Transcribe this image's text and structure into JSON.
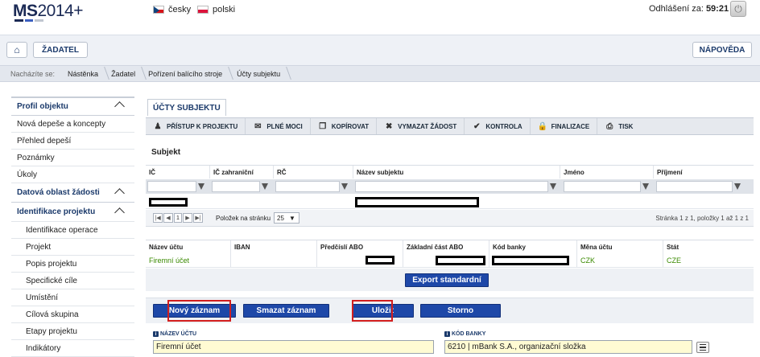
{
  "header": {
    "logo_ms": "MS",
    "logo_year": "2014+",
    "languages": [
      "česky",
      "polski"
    ],
    "logout_label": "Odhlášení za:",
    "logout_timer": "59:21",
    "logo_colors": [
      "#1b2a55",
      "#3b5fc0",
      "#c0c6d0"
    ]
  },
  "menubar": {
    "applicant_label": "ŽADATEL",
    "help_label": "NÁPOVĚDA"
  },
  "breadcrumb": {
    "label": "Nacházíte se:",
    "items": [
      "Nástěnka",
      "Žadatel",
      "Pořízení balícího stroje",
      "Účty subjektu"
    ]
  },
  "sidebar": {
    "items": [
      {
        "label": "Profil objektu",
        "type": "head"
      },
      {
        "label": "Nová depeše a koncepty",
        "type": "item"
      },
      {
        "label": "Přehled depeší",
        "type": "item"
      },
      {
        "label": "Poznámky",
        "type": "item"
      },
      {
        "label": "Úkoly",
        "type": "item"
      },
      {
        "label": "Datová oblast žádosti",
        "type": "head"
      },
      {
        "label": "Identifikace projektu",
        "type": "head"
      },
      {
        "label": "Identifikace operace",
        "type": "sub"
      },
      {
        "label": "Projekt",
        "type": "sub"
      },
      {
        "label": "Popis projektu",
        "type": "sub"
      },
      {
        "label": "Specifické cíle",
        "type": "sub"
      },
      {
        "label": "Umístění",
        "type": "sub"
      },
      {
        "label": "Cílová skupina",
        "type": "sub"
      },
      {
        "label": "Etapy projektu",
        "type": "sub"
      },
      {
        "label": "Indikátory",
        "type": "sub"
      }
    ]
  },
  "main": {
    "tab_label": "ÚČTY SUBJEKTU",
    "toolbar": [
      {
        "label": "PŘÍSTUP K PROJEKTU",
        "icon": "people-icon"
      },
      {
        "label": "PLNÉ MOCI",
        "icon": "envelope-icon"
      },
      {
        "label": "KOPÍROVAT",
        "icon": "copy-icon"
      },
      {
        "label": "VYMAZAT ŽÁDOST",
        "icon": "x-icon"
      },
      {
        "label": "KONTROLA",
        "icon": "check-icon"
      },
      {
        "label": "FINALIZACE",
        "icon": "lock-icon"
      },
      {
        "label": "TISK",
        "icon": "printer-icon"
      }
    ],
    "subject_title": "Subjekt",
    "subject_columns": [
      "IČ",
      "IČ zahraniční",
      "RČ",
      "Název subjektu",
      "Jméno",
      "Příjmení"
    ],
    "pager": {
      "current_page": "1",
      "per_page_label": "Položek na stránku",
      "per_page_value": "25",
      "info": "Stránka 1 z 1, položky 1 až 1 z 1"
    },
    "account_columns": [
      "Název účtu",
      "IBAN",
      "Předčíslí ABO",
      "Základní část ABO",
      "Kód banky",
      "Měna účtu",
      "Stát"
    ],
    "account_row": {
      "name": "Firemní účet",
      "currency": "CZK",
      "country": "CZE"
    },
    "export_label": "Export standardní",
    "buttons": {
      "new": "Nový záznam",
      "delete": "Smazat záznam",
      "save": "Uložit",
      "cancel": "Storno"
    },
    "fields": {
      "account_name_label": "NÁZEV ÚČTU",
      "account_name_value": "Firemní účet",
      "bank_code_label": "KÓD BANKY",
      "bank_code_value": "6210 | mBank S.A., organizační složka"
    }
  }
}
